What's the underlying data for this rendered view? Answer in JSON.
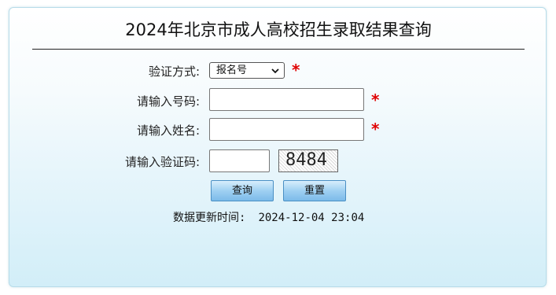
{
  "page": {
    "title": "2024年北京市成人高校招生录取结果查询"
  },
  "form": {
    "verify_method": {
      "label": "验证方式:",
      "selected": "报名号",
      "required_mark": "*"
    },
    "number_field": {
      "label": "请输入号码:",
      "value": "",
      "required_mark": "*"
    },
    "name_field": {
      "label": "请输入姓名:",
      "value": "",
      "required_mark": "*"
    },
    "captcha_field": {
      "label": "请输入验证码:",
      "value": "",
      "captcha_text": "8484"
    },
    "buttons": {
      "query_label": "查询",
      "reset_label": "重置"
    }
  },
  "update_info": {
    "label": "数据更新时间:",
    "timestamp": "2024-12-04 23:04"
  },
  "colors": {
    "required": "#e00000",
    "button_accent": "#7cbbe9",
    "panel_border": "#b7dce9"
  },
  "icons": {
    "select_arrow": "chevron-down-icon"
  }
}
